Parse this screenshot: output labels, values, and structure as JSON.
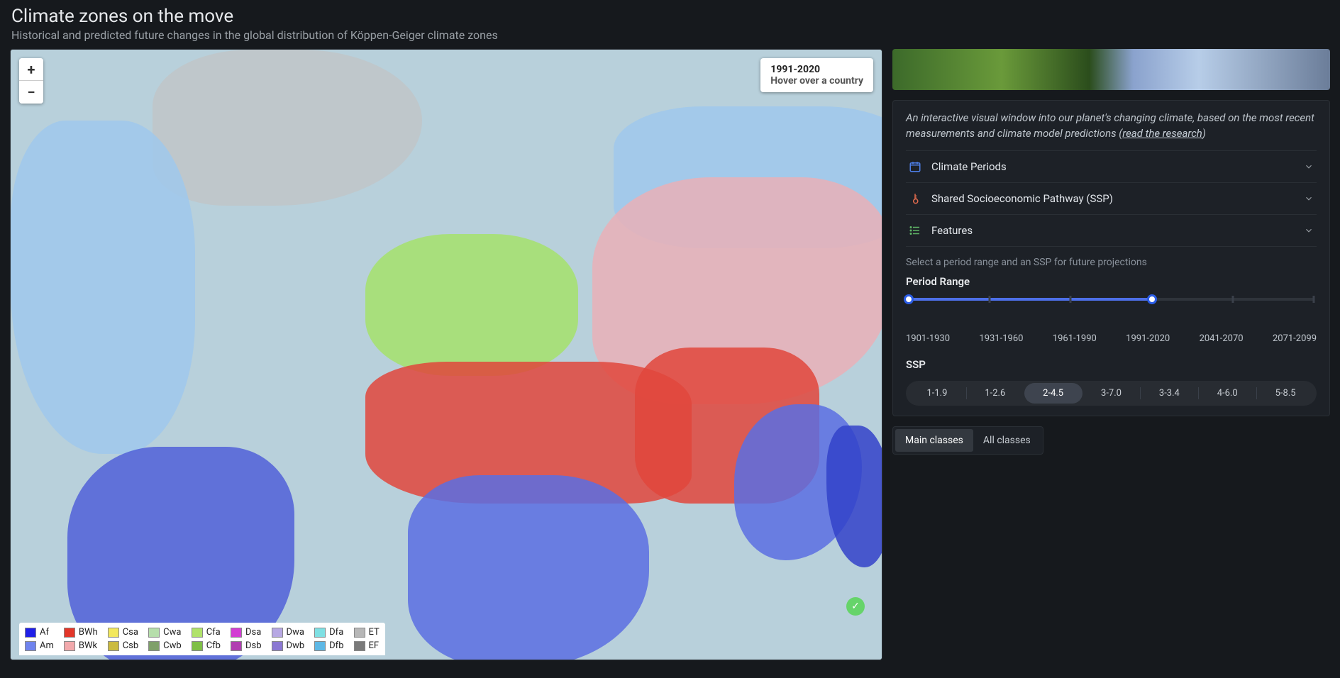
{
  "header": {
    "title": "Climate zones on the move",
    "subtitle": "Historical and predicted future changes in the global distribution of Köppen-Geiger climate zones"
  },
  "map": {
    "zoom_in": "+",
    "zoom_out": "−",
    "info_period": "1991-2020",
    "info_hint": "Hover over a country",
    "status_glyph": "✓"
  },
  "legend": [
    {
      "code": "Af",
      "color": "#1f1fe8"
    },
    {
      "code": "BWh",
      "color": "#e33629"
    },
    {
      "code": "Csa",
      "color": "#f3e85c"
    },
    {
      "code": "Cwa",
      "color": "#b6deab"
    },
    {
      "code": "Cfa",
      "color": "#b0e26a"
    },
    {
      "code": "Dsa",
      "color": "#d33ed3"
    },
    {
      "code": "Dwa",
      "color": "#b7a8e3"
    },
    {
      "code": "Dfa",
      "color": "#7fe0e3"
    },
    {
      "code": "ET",
      "color": "#b7b7b7"
    },
    {
      "code": "Am",
      "color": "#6f83ee"
    },
    {
      "code": "BWk",
      "color": "#f2a9ac"
    },
    {
      "code": "Csb",
      "color": "#cbbb3f"
    },
    {
      "code": "Cwb",
      "color": "#7fa06a"
    },
    {
      "code": "Cfb",
      "color": "#7fbf47"
    },
    {
      "code": "Dsb",
      "color": "#b13eb1"
    },
    {
      "code": "Dwb",
      "color": "#8b78d3"
    },
    {
      "code": "Dfb",
      "color": "#5eb8e5"
    },
    {
      "code": "EF",
      "color": "#7a7a7a"
    }
  ],
  "side": {
    "intro_a": "An interactive visual window into our planet's changing climate, based on the most recent measurements and climate model predictions (",
    "intro_link": "read the research",
    "intro_b": ")",
    "accordion": {
      "climate_periods": "Climate Periods",
      "ssp": "Shared Socioeconomic Pathway (SSP)",
      "features": "Features"
    },
    "helper": "Select a period range and an SSP for future projections",
    "period_range_label": "Period Range",
    "period_ticks": [
      "1901-1930",
      "1931-1960",
      "1961-1990",
      "1991-2020",
      "2041-2070",
      "2071-2099"
    ],
    "period_fill_left_pct": 0,
    "period_fill_right_pct": 60,
    "ssp_label": "SSP",
    "ssp_options": [
      "1-1.9",
      "1-2.6",
      "2-4.5",
      "3-7.0",
      "3-3.4",
      "4-6.0",
      "5-8.5"
    ],
    "ssp_active": "2-4.5",
    "tabs": {
      "main": "Main classes",
      "all": "All classes",
      "active": "main"
    }
  }
}
